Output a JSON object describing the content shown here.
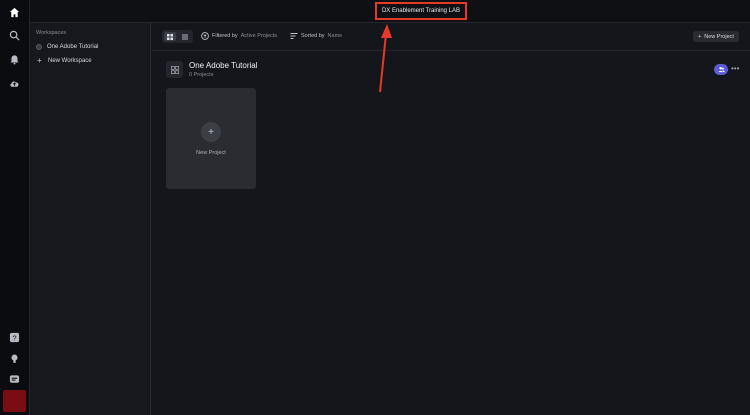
{
  "topbar": {
    "org_title": "DX Enablement Training LAB"
  },
  "rail": {
    "icons": [
      "home-icon",
      "search-icon",
      "bell-icon",
      "cloud-upload-icon",
      "help-icon",
      "lightbulb-icon",
      "chat-icon"
    ]
  },
  "sidebar": {
    "heading": "Workspaces",
    "items": [
      {
        "label": "One Adobe Tutorial",
        "icon": "workspace-dot-icon"
      },
      {
        "label": "New Workspace",
        "icon": "plus-icon"
      }
    ]
  },
  "toolbar": {
    "filter_label": "Filtered by",
    "filter_value": "Active Projects",
    "sort_label": "Sorted by",
    "sort_value": "Name",
    "new_project_label": "New Project"
  },
  "workspace": {
    "title": "One Adobe Tutorial",
    "project_count": "0 Projects"
  },
  "card": {
    "label": "New Project"
  },
  "colors": {
    "annotation": "#e53a2a",
    "accent": "#5b5bd6",
    "background": "#15161b"
  }
}
